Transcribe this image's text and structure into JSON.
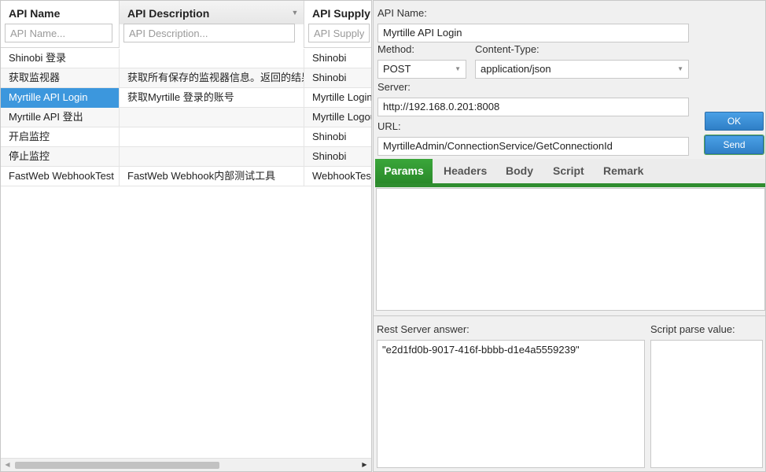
{
  "grid": {
    "columns": [
      {
        "title": "API Name",
        "filter_placeholder": "API Name..."
      },
      {
        "title": "API Description",
        "filter_placeholder": "API Description..."
      },
      {
        "title": "API Supply",
        "filter_placeholder": "API Supply..."
      }
    ],
    "sort_menu_icon": "dropdown-arrow-icon",
    "rows": [
      {
        "name": "Shinobi 登录",
        "description": "",
        "supply": "Shinobi"
      },
      {
        "name": "获取监视器",
        "description": "获取所有保存的监视器信息。返回的结果",
        "supply": "Shinobi"
      },
      {
        "name": "Myrtille API Login",
        "description": "获取Myrtille 登录的账号",
        "supply": "Myrtille Login"
      },
      {
        "name": "Myrtille API 登出",
        "description": "",
        "supply": "Myrtille Logout"
      },
      {
        "name": "开启监控",
        "description": "",
        "supply": "Shinobi"
      },
      {
        "name": "停止监控",
        "description": "",
        "supply": "Shinobi"
      },
      {
        "name": "FastWeb WebhookTest",
        "description": "FastWeb Webhook内部测试工具",
        "supply": "WebhookTest"
      }
    ],
    "selected_row": 2,
    "selection_color": "#3c97dd"
  },
  "form": {
    "api_name_label": "API Name:",
    "api_name_value": "Myrtille API Login",
    "method_label": "Method:",
    "method_value": "POST",
    "content_type_label": "Content-Type:",
    "content_type_value": "application/json",
    "server_label": "Server:",
    "server_value": "http://192.168.0.201:8008",
    "url_label": "URL:",
    "url_value": "MyrtilleAdmin/ConnectionService/GetConnectionId",
    "ok_label": "OK",
    "send_label": "Send",
    "button_color": "#3a8fd8",
    "tabs": [
      "Params",
      "Headers",
      "Body",
      "Script",
      "Remark"
    ],
    "active_tab": "Params",
    "tab_accent_color": "#2f8d2f",
    "answer_label": "Rest Server answer:",
    "answer_value": "\"e2d1fd0b-9017-416f-bbbb-d1e4a5559239\"",
    "script_label": "Script parse value:",
    "script_value": ""
  }
}
